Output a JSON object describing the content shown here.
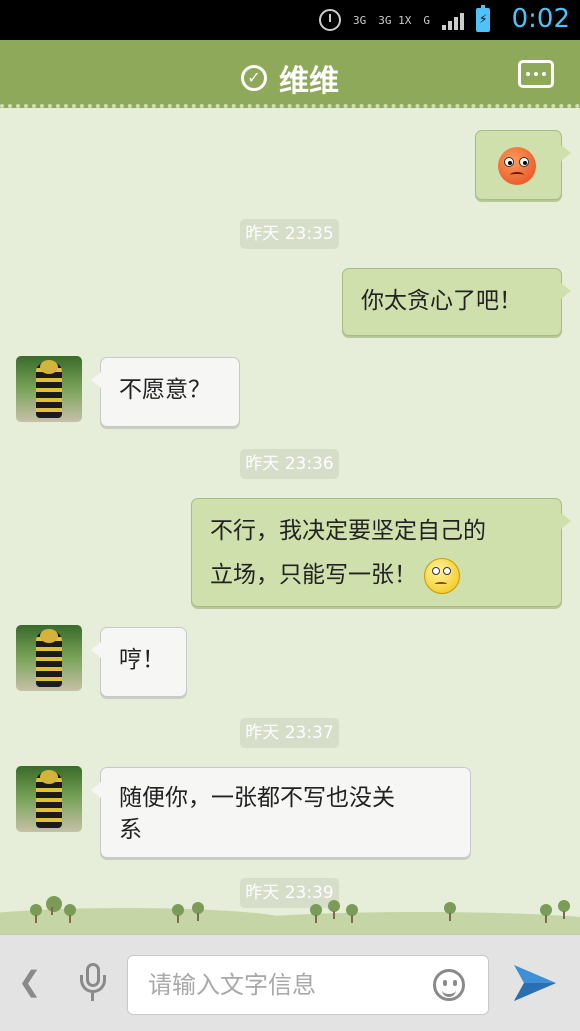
{
  "status_bar": {
    "time": "0:02",
    "network_label_1": "3G",
    "network_label_2": "3G 1X",
    "network_label_3": "G"
  },
  "header": {
    "title": "维维"
  },
  "messages": [
    {
      "type": "timestamp",
      "text": "昨天 23:35"
    },
    {
      "type": "outgoing",
      "text": "你太贪心了吧！"
    },
    {
      "type": "incoming",
      "text": "不愿意？"
    },
    {
      "type": "timestamp",
      "text": "昨天 23:36"
    },
    {
      "type": "outgoing",
      "line1": "不行，我决定要坚定自己的",
      "line2": "立场，只能写一张！"
    },
    {
      "type": "incoming",
      "text": "哼！"
    },
    {
      "type": "timestamp",
      "text": "昨天 23:37"
    },
    {
      "type": "incoming",
      "line1": "随便你，一张都不写也没关",
      "line2": "系"
    },
    {
      "type": "timestamp",
      "text": "昨天 23:39"
    }
  ],
  "input_bar": {
    "placeholder": "请输入文字信息"
  },
  "colors": {
    "header_green": "#8ea95a",
    "outgoing_bubble": "#cfe0ad",
    "incoming_bubble": "#f6f6f5",
    "chat_background": "#e6edd9",
    "status_accent": "#4fc3f7"
  },
  "icons": {
    "verified": "check-circle-icon",
    "menu": "more-icon",
    "back": "chevron-left-icon",
    "voice": "microphone-icon",
    "emoji": "smiley-icon",
    "send": "paper-plane-icon"
  }
}
